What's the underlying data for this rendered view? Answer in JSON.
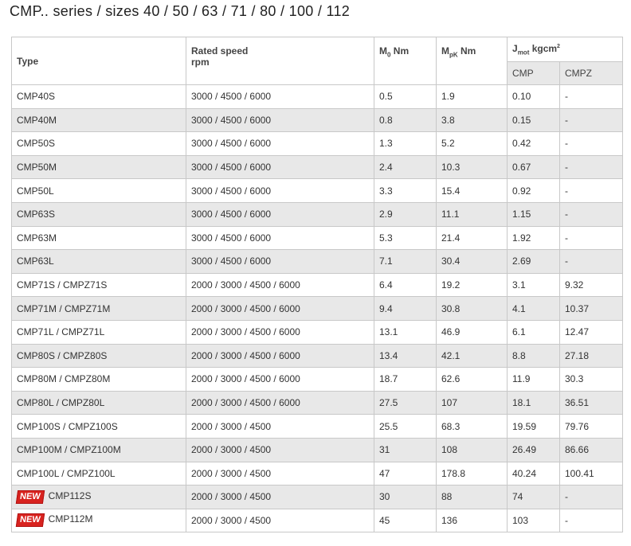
{
  "title": "CMP.. series / sizes 40 / 50 / 63 / 71 / 80 / 100 / 112",
  "colors": {
    "grid": "#c8c8c8",
    "stripe": "#e8e8e8",
    "new_badge": "#d8231f"
  },
  "header": {
    "type": "Type",
    "speed_line1": "Rated speed",
    "speed_line2": "rpm",
    "m0_main": "M",
    "m0_sub": "0",
    "m0_unit": " Nm",
    "mpk_main": "M",
    "mpk_sub": "pK",
    "mpk_unit": " Nm",
    "j_main": "J",
    "j_sub": "mot",
    "j_unit": " kgcm",
    "j_sup": "2",
    "cmp": "CMP",
    "cmpz": "CMPZ"
  },
  "rows": [
    {
      "type": "CMP40S",
      "speed": "3000 / 4500 / 6000",
      "m0": "0.5",
      "mpk": "1.9",
      "cmp": "0.10",
      "cmpz": "-",
      "new": ""
    },
    {
      "type": "CMP40M",
      "speed": "3000 / 4500 / 6000",
      "m0": "0.8",
      "mpk": "3.8",
      "cmp": "0.15",
      "cmpz": "-",
      "new": ""
    },
    {
      "type": "CMP50S",
      "speed": "3000 / 4500 / 6000",
      "m0": "1.3",
      "mpk": "5.2",
      "cmp": "0.42",
      "cmpz": "-",
      "new": ""
    },
    {
      "type": "CMP50M",
      "speed": "3000 / 4500 / 6000",
      "m0": "2.4",
      "mpk": "10.3",
      "cmp": "0.67",
      "cmpz": "-",
      "new": ""
    },
    {
      "type": "CMP50L",
      "speed": "3000 / 4500 / 6000",
      "m0": "3.3",
      "mpk": "15.4",
      "cmp": "0.92",
      "cmpz": "-",
      "new": ""
    },
    {
      "type": "CMP63S",
      "speed": "3000 / 4500 / 6000",
      "m0": "2.9",
      "mpk": "11.1",
      "cmp": "1.15",
      "cmpz": "-",
      "new": ""
    },
    {
      "type": "CMP63M",
      "speed": "3000 / 4500 / 6000",
      "m0": "5.3",
      "mpk": "21.4",
      "cmp": "1.92",
      "cmpz": "-",
      "new": ""
    },
    {
      "type": "CMP63L",
      "speed": "3000 / 4500 / 6000",
      "m0": "7.1",
      "mpk": "30.4",
      "cmp": "2.69",
      "cmpz": "-",
      "new": ""
    },
    {
      "type": "CMP71S / CMPZ71S",
      "speed": "2000 / 3000 / 4500 / 6000",
      "m0": "6.4",
      "mpk": "19.2",
      "cmp": "3.1",
      "cmpz": "9.32",
      "new": ""
    },
    {
      "type": "CMP71M / CMPZ71M",
      "speed": "2000 / 3000 / 4500 / 6000",
      "m0": "9.4",
      "mpk": "30.8",
      "cmp": "4.1",
      "cmpz": "10.37",
      "new": ""
    },
    {
      "type": "CMP71L / CMPZ71L",
      "speed": "2000 / 3000 / 4500 / 6000",
      "m0": "13.1",
      "mpk": "46.9",
      "cmp": "6.1",
      "cmpz": "12.47",
      "new": ""
    },
    {
      "type": "CMP80S / CMPZ80S",
      "speed": "2000 / 3000 / 4500 / 6000",
      "m0": "13.4",
      "mpk": "42.1",
      "cmp": "8.8",
      "cmpz": "27.18",
      "new": ""
    },
    {
      "type": "CMP80M / CMPZ80M",
      "speed": "2000 / 3000 / 4500 / 6000",
      "m0": "18.7",
      "mpk": "62.6",
      "cmp": "11.9",
      "cmpz": "30.3",
      "new": ""
    },
    {
      "type": "CMP80L / CMPZ80L",
      "speed": "2000 / 3000 / 4500 / 6000",
      "m0": "27.5",
      "mpk": "107",
      "cmp": "18.1",
      "cmpz": "36.51",
      "new": ""
    },
    {
      "type": "CMP100S / CMPZ100S",
      "speed": "2000 / 3000 / 4500",
      "m0": "25.5",
      "mpk": "68.3",
      "cmp": "19.59",
      "cmpz": "79.76",
      "new": ""
    },
    {
      "type": "CMP100M / CMPZ100M",
      "speed": "2000 / 3000 / 4500",
      "m0": "31",
      "mpk": "108",
      "cmp": "26.49",
      "cmpz": "86.66",
      "new": ""
    },
    {
      "type": "CMP100L / CMPZ100L",
      "speed": "2000 / 3000 / 4500",
      "m0": "47",
      "mpk": "178.8",
      "cmp": "40.24",
      "cmpz": "100.41",
      "new": ""
    },
    {
      "type": "CMP112S",
      "speed": "2000 / 3000 / 4500",
      "m0": "30",
      "mpk": "88",
      "cmp": "74",
      "cmpz": "-",
      "new": "NEW"
    },
    {
      "type": "CMP112M",
      "speed": "2000 / 3000 / 4500",
      "m0": "45",
      "mpk": "136",
      "cmp": "103",
      "cmpz": "-",
      "new": "NEW"
    }
  ]
}
